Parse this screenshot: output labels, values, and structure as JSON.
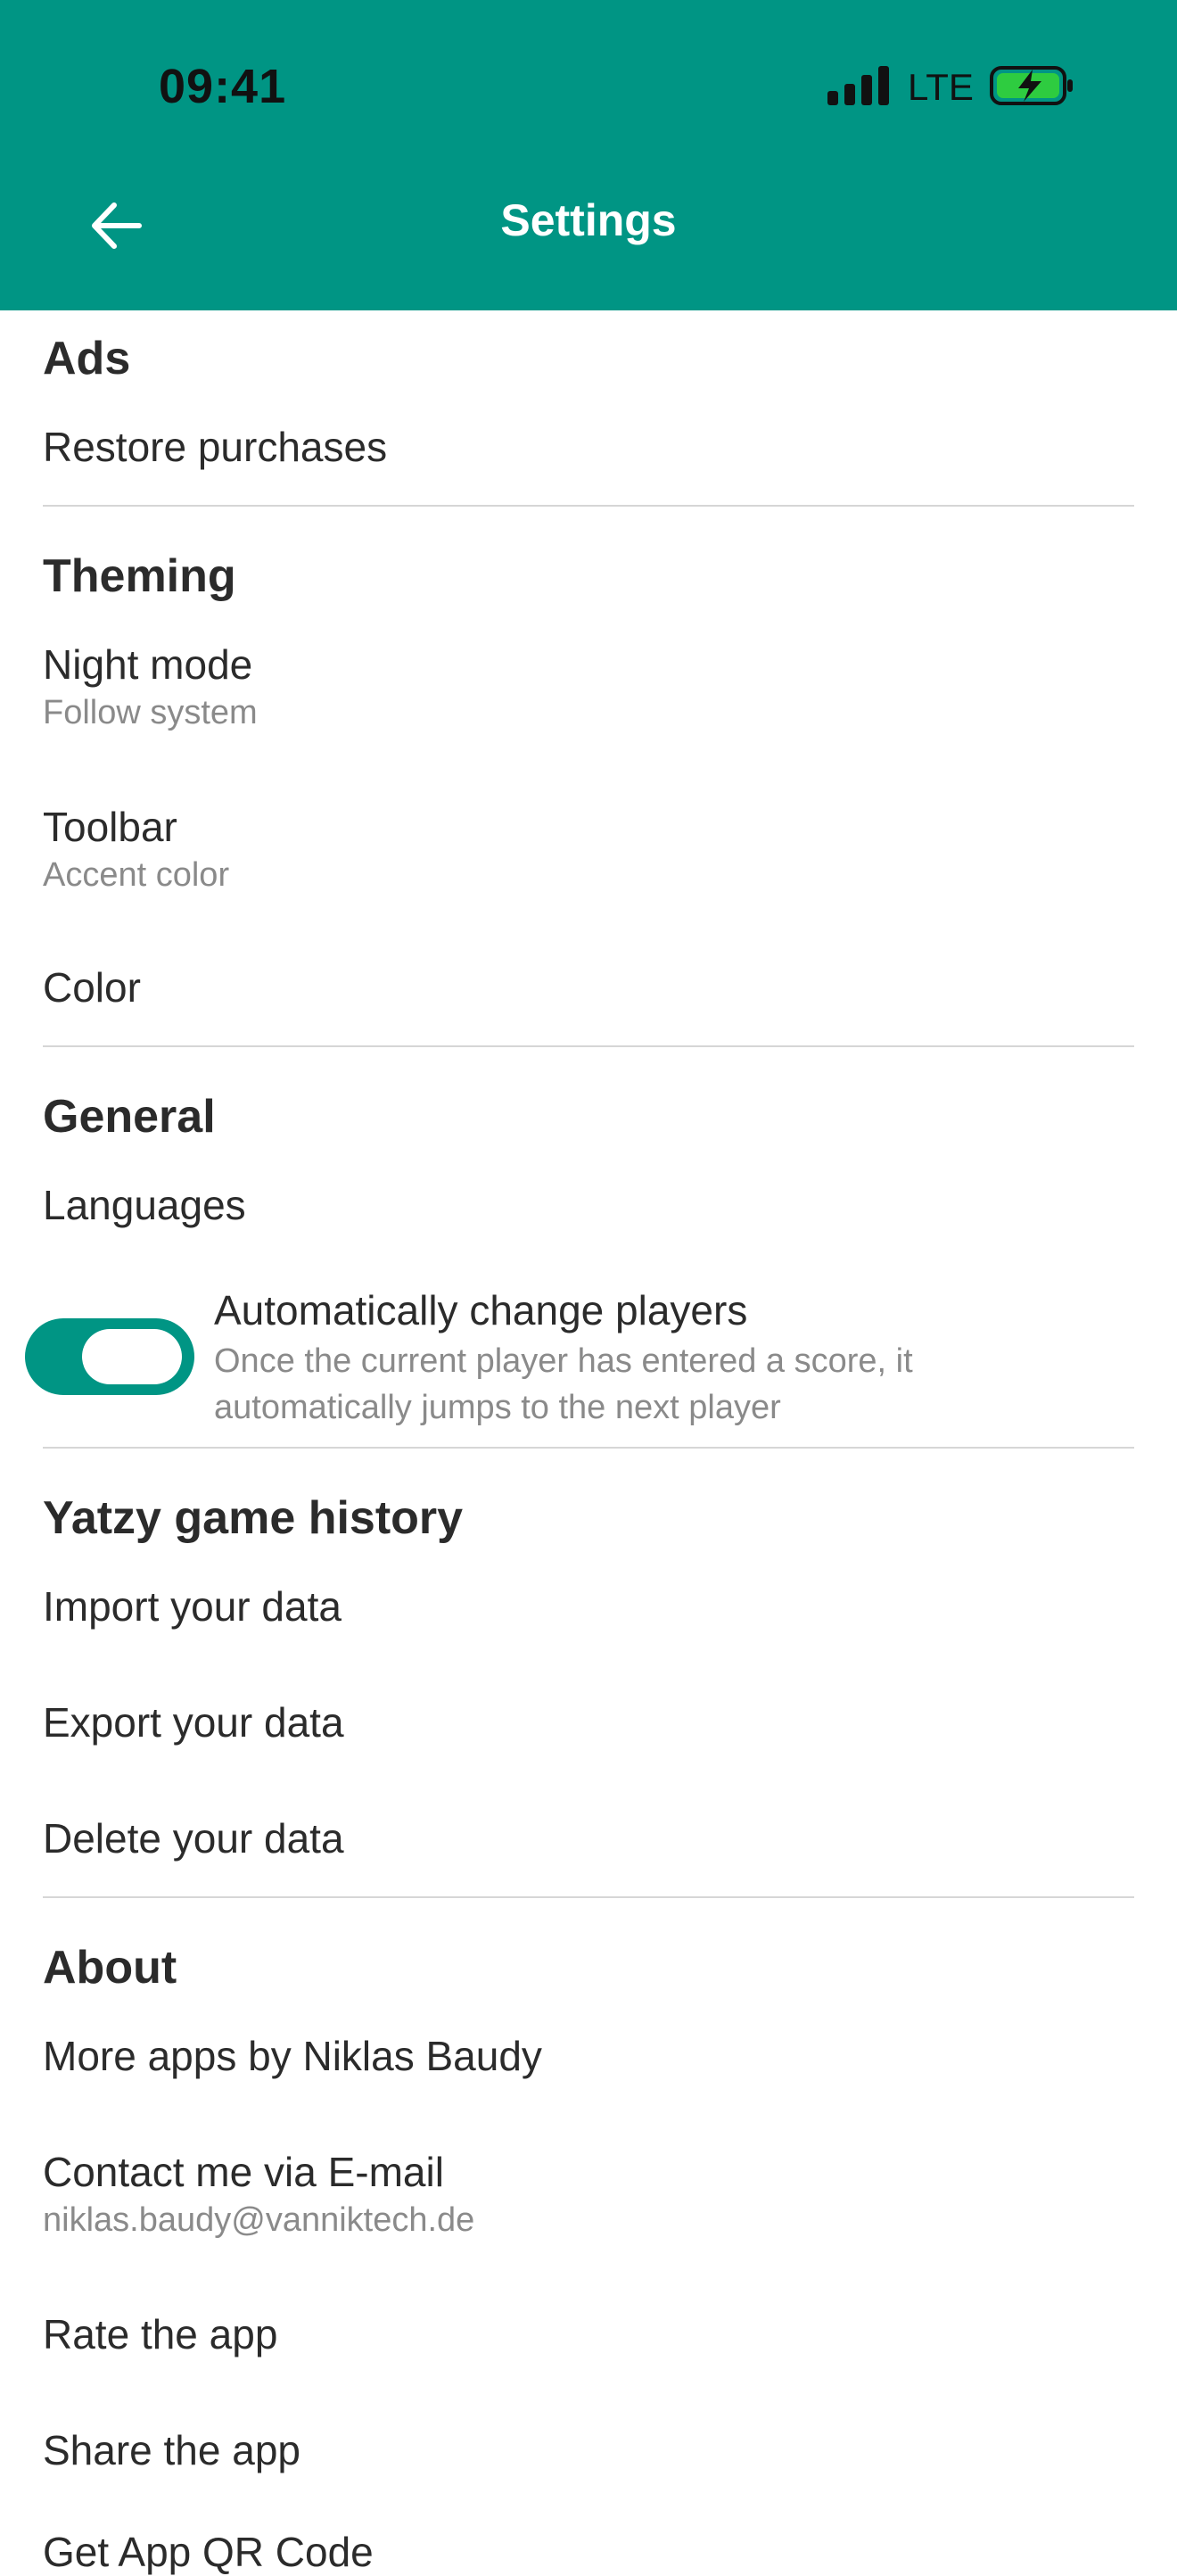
{
  "status_bar": {
    "time": "09:41",
    "network": "LTE",
    "icons": [
      "signal-icon",
      "battery-charging-icon"
    ]
  },
  "header": {
    "title": "Settings",
    "back_icon": "arrow-left-icon",
    "background_color": "#009584"
  },
  "sections": {
    "ads": {
      "title": "Ads",
      "restore": "Restore purchases"
    },
    "theming": {
      "title": "Theming",
      "night_mode": "Night mode",
      "night_mode_value": "Follow system",
      "toolbar": "Toolbar",
      "toolbar_value": "Accent color",
      "color": "Color"
    },
    "general": {
      "title": "General",
      "languages": "Languages",
      "auto_change_label": "Automatically change players",
      "auto_change_desc": "Once the current player has entered a score, it automatically jumps to the next player",
      "auto_change_enabled": true
    },
    "history": {
      "title": "Yatzy game history",
      "import": "Import your data",
      "export": "Export your data",
      "delete": "Delete your data"
    },
    "about": {
      "title": "About",
      "more_apps": "More apps by Niklas Baudy",
      "contact": "Contact me via E-mail",
      "contact_email": "niklas.baudy@vanniktech.de",
      "rate": "Rate the app",
      "share": "Share the app",
      "qr": "Get App QR Code"
    }
  },
  "colors": {
    "accent": "#009584",
    "text": "#2b2b2b",
    "secondary_text": "#8a8a8a",
    "divider": "#d6d6d6"
  }
}
